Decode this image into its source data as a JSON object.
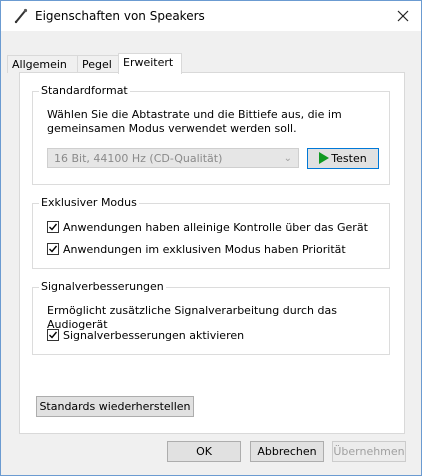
{
  "window": {
    "title": "Eigenschaften von Speakers",
    "close_icon": "close-icon",
    "title_icon": "speaker-properties-icon"
  },
  "tabs": [
    {
      "label": "Allgemein",
      "active": false
    },
    {
      "label": "Pegel",
      "active": false
    },
    {
      "label": "Erweitert",
      "active": true
    }
  ],
  "standardformat": {
    "title": "Standardformat",
    "description": "Wählen Sie die Abtastrate und die Bittiefe aus, die im gemeinsamen Modus verwendet werden soll.",
    "format_value": "16 Bit, 44100 Hz (CD-Qualität)",
    "test_button": "Testen",
    "test_icon": "play-icon"
  },
  "exklusiv": {
    "title": "Exklusiver Modus",
    "options": [
      {
        "label": "Anwendungen haben alleinige Kontrolle über das Gerät",
        "checked": true
      },
      {
        "label": "Anwendungen im exklusiven Modus haben Priorität",
        "checked": true
      }
    ]
  },
  "signal": {
    "title": "Signalverbesserungen",
    "description": "Ermöglicht zusätzliche Signalverarbeitung durch das Audiogerät",
    "option": {
      "label": "Signalverbesserungen aktivieren",
      "checked": true
    }
  },
  "restore_button": "Standards wiederherstellen",
  "footer": {
    "ok": "OK",
    "cancel": "Abbrechen",
    "apply": "Übernehmen"
  },
  "colors": {
    "accent": "#0078d7",
    "play_green": "#119a22"
  }
}
